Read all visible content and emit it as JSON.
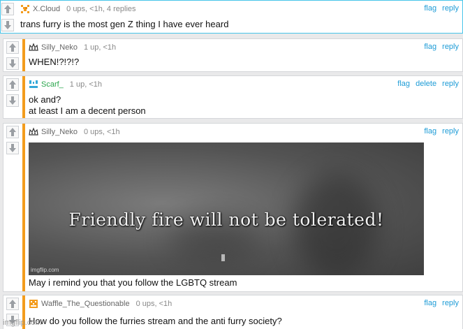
{
  "comments": [
    {
      "username": "X.Cloud",
      "stats": "0 ups, <1h, 4 replies",
      "text": "trans furry is the most gen Z thing I have ever heard",
      "actions": [
        "flag",
        "reply"
      ],
      "avatar_icon": "x-pixel-avatar-icon"
    },
    {
      "username": "Silly_Neko",
      "stats": "1 up, <1h",
      "text": "WHEN!?!?!?",
      "actions": [
        "flag",
        "reply"
      ],
      "avatar_icon": "crown-avatar-icon"
    },
    {
      "username": "Scarf_",
      "stats": "1 up, <1h",
      "lines": [
        "ok and?",
        "at least I am a decent person"
      ],
      "actions": [
        "flag",
        "delete",
        "reply"
      ],
      "avatar_icon": "blue-face-avatar-icon"
    },
    {
      "username": "Silly_Neko",
      "stats": "0 ups, <1h",
      "meme_caption": "Friendly fire will not be tolerated!",
      "meme_watermark": "imgflip.com",
      "text": "May i remind you that you follow the LGBTQ stream",
      "actions": [
        "flag",
        "reply"
      ],
      "avatar_icon": "crown-avatar-icon"
    },
    {
      "username": "Waffle_The_Questionable",
      "stats": "0 ups, <1h",
      "text": "How do you follow the furries stream and the anti furry society?",
      "actions": [
        "flag",
        "reply"
      ],
      "avatar_icon": "orange-pixel-avatar-icon"
    }
  ],
  "footer_watermark": "imgflip.com",
  "colors": {
    "accent": "#f39c1d",
    "link": "#1c9bd6",
    "highlight_border": "#47c5ea",
    "username_green": "#2aa64c"
  }
}
